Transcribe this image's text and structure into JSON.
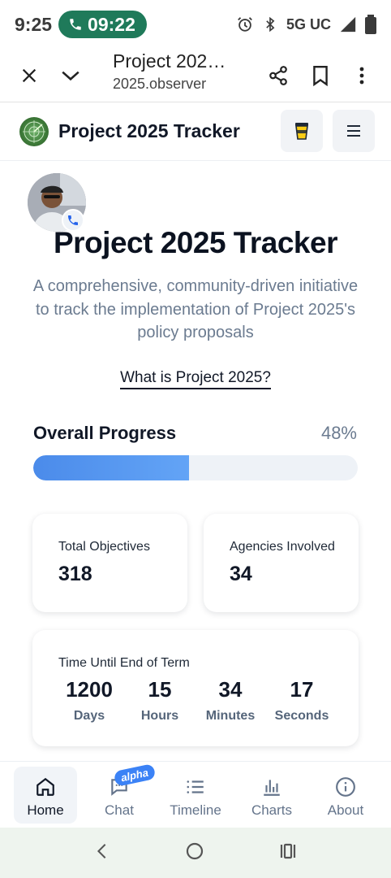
{
  "status_bar": {
    "time": "9:25",
    "call_time": "09:22",
    "network": "5G UC"
  },
  "browser": {
    "page_title": "Project 202…",
    "url": "2025.observer"
  },
  "site_header": {
    "title": "Project 2025 Tracker",
    "logo_icon": "radar-logo-icon",
    "coffee_icon": "coffee-cup-icon",
    "menu_icon": "hamburger-menu-icon"
  },
  "hero": {
    "title": "Project 2025 Tracker",
    "subtitle": "A comprehensive, community-driven initiative to track the implementation of Project 2025's policy proposals",
    "link": "What is Project 2025?"
  },
  "progress": {
    "label": "Overall Progress",
    "percent_text": "48%",
    "value": 0.48,
    "color_start": "#4b8bea",
    "color_end": "#63a4f6"
  },
  "stats": {
    "objectives": {
      "label": "Total Objectives",
      "value": "318"
    },
    "agencies": {
      "label": "Agencies Involved",
      "value": "34"
    }
  },
  "countdown": {
    "label": "Time Until End of Term",
    "units": [
      {
        "value": "1200",
        "unit": "Days"
      },
      {
        "value": "15",
        "unit": "Hours"
      },
      {
        "value": "34",
        "unit": "Minutes"
      },
      {
        "value": "17",
        "unit": "Seconds"
      }
    ]
  },
  "bottom_nav": {
    "items": [
      {
        "label": "Home",
        "icon": "home-icon",
        "active": true
      },
      {
        "label": "Chat",
        "icon": "chat-icon",
        "active": false
      },
      {
        "label": "Timeline",
        "icon": "list-icon",
        "active": false
      },
      {
        "label": "Charts",
        "icon": "bar-chart-icon",
        "active": false
      },
      {
        "label": "About",
        "icon": "info-icon",
        "active": false
      }
    ],
    "chat_badge": "alpha"
  }
}
